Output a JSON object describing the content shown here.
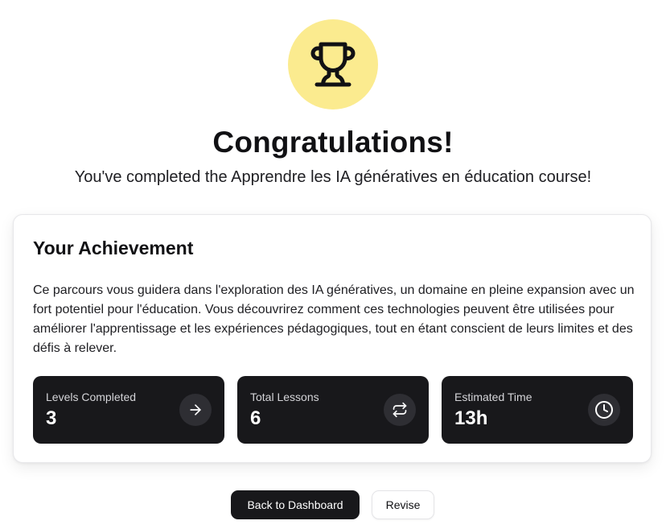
{
  "header": {
    "icon": "trophy-icon",
    "title": "Congratulations!",
    "subtitle": "You've completed the Apprendre les IA génératives en éducation course!"
  },
  "achievement": {
    "title": "Your Achievement",
    "description": "Ce parcours vous guidera dans l'exploration des IA génératives, un domaine en pleine expansion avec un fort potentiel pour l'éducation. Vous découvrirez comment ces technologies peuvent être utilisées pour améliorer l'apprentissage et les expériences pédagogiques, tout en étant conscient de leurs limites et des défis à relever.",
    "stats": [
      {
        "label": "Levels Completed",
        "value": "3",
        "icon": "arrow-right-icon"
      },
      {
        "label": "Total Lessons",
        "value": "6",
        "icon": "repeat-icon"
      },
      {
        "label": "Estimated Time",
        "value": "13h",
        "icon": "clock-icon"
      }
    ]
  },
  "actions": {
    "primary_label": "Back to Dashboard",
    "secondary_label": "Revise"
  },
  "colors": {
    "trophy_bg": "#fbeb8f",
    "stat_bg": "#18181b",
    "primary_button_bg": "#18181b"
  }
}
